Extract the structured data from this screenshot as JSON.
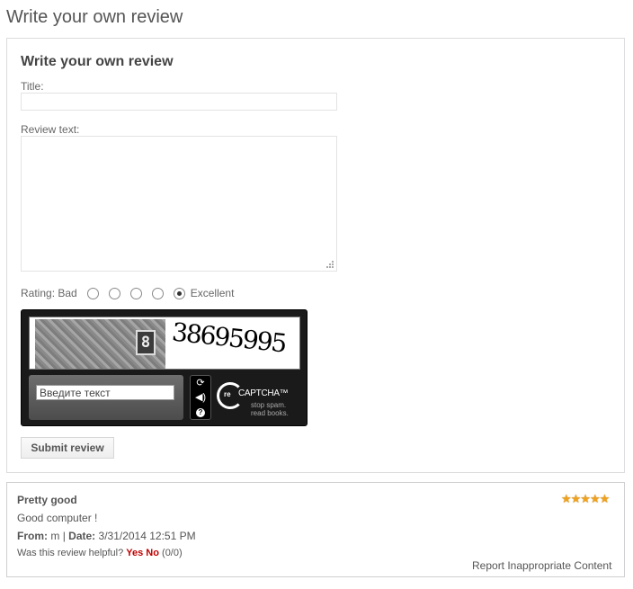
{
  "page": {
    "title": "Write your own review"
  },
  "form": {
    "heading": "Write your own review",
    "title_label": "Title:",
    "title_value": "",
    "review_label": "Review text:",
    "review_value": "",
    "rating": {
      "label": "Rating: Bad",
      "high_label": "Excellent",
      "options": 5,
      "selected": 5
    },
    "submit_label": "Submit review"
  },
  "captcha": {
    "image_number": "8",
    "image_word": "38695995",
    "input_placeholder": "Введите текст",
    "buttons": [
      "refresh-icon",
      "audio-icon",
      "help-icon"
    ],
    "logo_prefix": "re",
    "logo_word": "CAPTCHA™",
    "tagline_1": "stop spam.",
    "tagline_2": "read books."
  },
  "review": {
    "title": "Pretty good",
    "stars": 5,
    "stars_text": "★★★★★",
    "body": "Good computer !",
    "from_label": "From:",
    "author": "m",
    "separator": "|",
    "date_label": "Date:",
    "date": "3/31/2014 12:51 PM",
    "helpful_question": "Was this review helpful?",
    "yes": "Yes",
    "no": "No",
    "counts": "(0/0)",
    "report": "Report Inappropriate Content"
  }
}
